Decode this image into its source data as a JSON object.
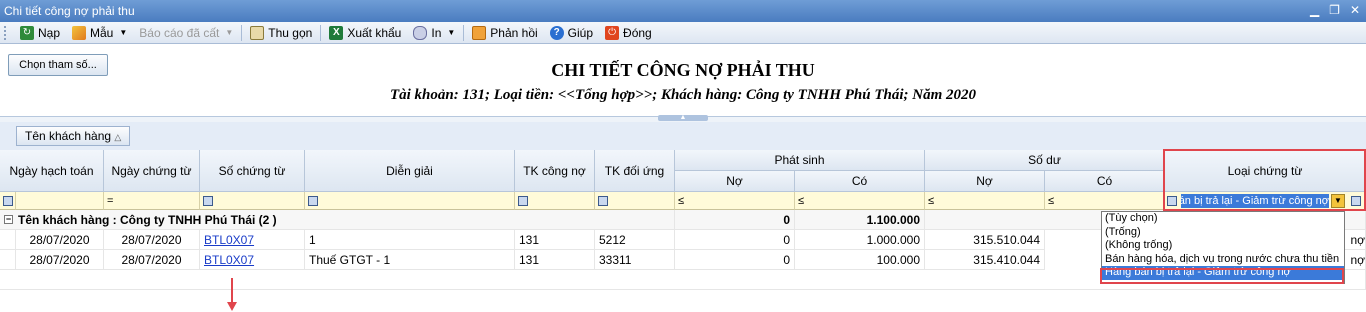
{
  "window": {
    "title": "Chi tiết công nợ phải thu"
  },
  "toolbar": {
    "nap": "Nạp",
    "mau": "Mẫu",
    "bao_cao": "Báo cáo đã cất",
    "thu_gon": "Thu gọn",
    "xuat_khau": "Xuất khẩu",
    "in": "In",
    "phan_hoi": "Phản hồi",
    "giup": "Giúp",
    "dong": "Đóng"
  },
  "header": {
    "param_button": "Chọn tham số...",
    "title": "CHI TIẾT CÔNG NỢ PHẢI THU",
    "subtitle": "Tài khoản: 131; Loại tiền: <<Tổng hợp>>; Khách hàng: Công ty TNHH Phú Thái; Năm 2020"
  },
  "group_panel": {
    "chip": "Tên khách hàng"
  },
  "columns": {
    "ngay_hach_toan": "Ngày hạch toán",
    "ngay_chung_tu": "Ngày chứng từ",
    "so_chung_tu": "Số chứng từ",
    "dien_giai": "Diễn giải",
    "tk_cong_no": "TK công nợ",
    "tk_doi_ung": "TK đối ứng",
    "phat_sinh": "Phát sinh",
    "so_du": "Số dư",
    "no": "Nợ",
    "co": "Có",
    "loai_chung_tu": "Loại chứng từ"
  },
  "filter": {
    "eq": "=",
    "le": "≤",
    "loai_value": "Hàng bán bị trả lại - Giảm trừ công nợ"
  },
  "group_row": {
    "label": "Tên khách hàng : Công ty TNHH Phú Thái (2 )",
    "ps_no": "0",
    "ps_co": "1.100.000"
  },
  "rows": [
    {
      "ngay_ht": "28/07/2020",
      "ngay_ct": "28/07/2020",
      "so_ct": "BTL0X07",
      "dien_giai": "1",
      "tk_cn": "131",
      "tk_du": "5212",
      "ps_no": "0",
      "ps_co": "1.000.000",
      "sd_no": "315.510.044",
      "tail": "nợ"
    },
    {
      "ngay_ht": "28/07/2020",
      "ngay_ct": "28/07/2020",
      "so_ct": "BTL0X07",
      "dien_giai": "Thuế GTGT - 1",
      "tk_cn": "131",
      "tk_du": "33311",
      "ps_no": "0",
      "ps_co": "100.000",
      "sd_no": "315.410.044",
      "tail": "nợ"
    }
  ],
  "dropdown": {
    "options": [
      "(Tùy chọn)",
      "(Trống)",
      "(Không trống)",
      "Bán hàng hóa, dịch vụ trong nước chưa thu tiền",
      "Hàng bán bị trả lại - Giảm trừ công nợ"
    ],
    "selected_index": 4
  },
  "colors": {
    "highlight": "#e0454c",
    "accent": "#3b7ad9"
  }
}
